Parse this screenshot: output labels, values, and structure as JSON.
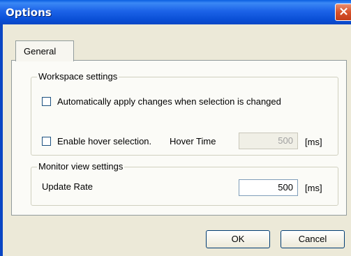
{
  "window": {
    "title": "Options",
    "close_glyph": "×",
    "titlebar_color": "#0a5ee0"
  },
  "tabs": [
    {
      "label": "General",
      "selected": true
    }
  ],
  "workspace": {
    "legend": "Workspace settings",
    "auto_apply": {
      "label": "Automatically apply changes when selection is changed",
      "checked": false
    },
    "hover": {
      "label": "Enable hover selection.",
      "checked": false
    },
    "hover_time": {
      "label": "Hover Time",
      "value": "500",
      "unit": "[ms]",
      "enabled": false
    }
  },
  "monitor": {
    "legend": "Monitor view settings",
    "update_rate": {
      "label": "Update Rate",
      "value": "500",
      "unit": "[ms]"
    }
  },
  "buttons": {
    "ok": "OK",
    "cancel": "Cancel"
  }
}
